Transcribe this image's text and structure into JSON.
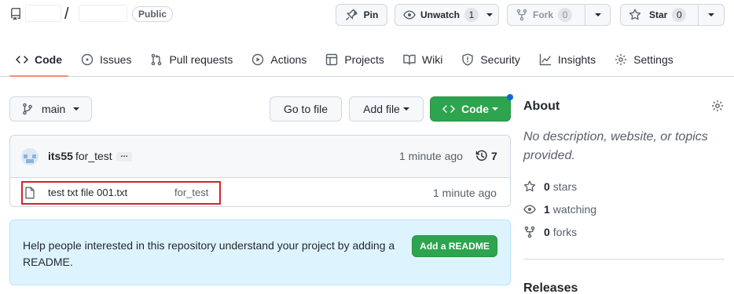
{
  "header": {
    "slash": "/",
    "visibility": "Public",
    "pin_label": "Pin",
    "watch_label": "Unwatch",
    "watch_count": "1",
    "fork_label": "Fork",
    "fork_count": "0",
    "star_label": "Star",
    "star_count": "0"
  },
  "tabs": [
    {
      "label": "Code",
      "icon": "code-icon",
      "selected": true
    },
    {
      "label": "Issues",
      "icon": "issue-icon"
    },
    {
      "label": "Pull requests",
      "icon": "pull-request-icon"
    },
    {
      "label": "Actions",
      "icon": "play-icon"
    },
    {
      "label": "Projects",
      "icon": "table-icon"
    },
    {
      "label": "Wiki",
      "icon": "book-icon"
    },
    {
      "label": "Security",
      "icon": "shield-icon"
    },
    {
      "label": "Insights",
      "icon": "graph-icon"
    },
    {
      "label": "Settings",
      "icon": "gear-icon"
    }
  ],
  "toolbar": {
    "branch": "main",
    "go_to_file": "Go to file",
    "add_file": "Add file",
    "code": "Code"
  },
  "commit": {
    "author": "its55",
    "message": "for_test",
    "ellipsis": "…",
    "time": "1 minute ago",
    "history_count": "7"
  },
  "files": [
    {
      "name": "test txt file 001.txt",
      "commit_message": "for_test",
      "time": "1 minute ago"
    }
  ],
  "readme": {
    "text": "Help people interested in this repository understand your project by adding a README.",
    "button": "Add a README"
  },
  "about": {
    "title": "About",
    "description": "No description, website, or topics provided.",
    "stars_count": "0",
    "stars_label": "stars",
    "watching_count": "1",
    "watching_label": "watching",
    "forks_count": "0",
    "forks_label": "forks",
    "releases_title": "Releases"
  },
  "colors": {
    "accent_green": "#2da44e",
    "tab_underline": "#fd8c73",
    "highlight_red": "#d1242f",
    "readme_bg": "#ddf4ff"
  }
}
